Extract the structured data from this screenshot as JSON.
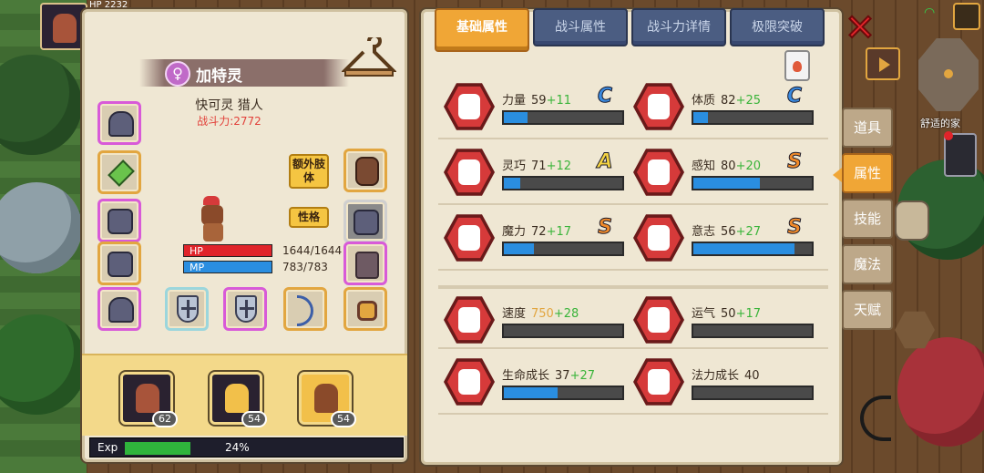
{
  "hud": {
    "mini_hp": "HP 2232",
    "location": "舒适的家"
  },
  "character": {
    "gender_symbol": "♀",
    "name": "加特灵",
    "class": "快可灵 猎人",
    "power_label": "战斗力:",
    "power_value": "2772",
    "extra_body_button": "额外肢体",
    "personality_button": "性格",
    "hp_label": "HP",
    "hp_value": "1644/1644",
    "mp_label": "MP",
    "mp_value": "783/783"
  },
  "party": [
    {
      "level": "62"
    },
    {
      "level": "54"
    },
    {
      "level": "54"
    }
  ],
  "exp": {
    "label": "Exp",
    "value": "24%",
    "fraction": 0.24
  },
  "tabs": [
    {
      "label": "基础属性",
      "active": true
    },
    {
      "label": "战斗属性",
      "active": false
    },
    {
      "label": "战斗力详情",
      "active": false
    },
    {
      "label": "极限突破",
      "active": false
    }
  ],
  "stats": [
    {
      "name": "力量",
      "value": "59",
      "bonus": "+11",
      "grade": "C",
      "fill": 0.2,
      "icon": "muscle-icon"
    },
    {
      "name": "体质",
      "value": "82",
      "bonus": "+25",
      "grade": "C",
      "fill": 0.12,
      "icon": "body-icon"
    },
    {
      "name": "灵巧",
      "value": "71",
      "bonus": "+12",
      "grade": "A",
      "fill": 0.14,
      "icon": "running-icon"
    },
    {
      "name": "感知",
      "value": "80",
      "bonus": "+20",
      "grade": "S",
      "fill": 0.56,
      "icon": "eye-icon"
    },
    {
      "name": "魔力",
      "value": "72",
      "bonus": "+17",
      "grade": "S",
      "fill": 0.25,
      "icon": "hexagram-icon"
    },
    {
      "name": "意志",
      "value": "56",
      "bonus": "+27",
      "grade": "S",
      "fill": 0.85,
      "icon": "head-icon"
    },
    {
      "name": "速度",
      "value": "750",
      "bonus": "+28",
      "grade": "",
      "fill": 0,
      "icon": "wing-icon",
      "value_color": "gold"
    },
    {
      "name": "运气",
      "value": "50",
      "bonus": "+17",
      "grade": "",
      "fill": 0,
      "icon": "clover-icon"
    },
    {
      "name": "生命成长",
      "value": "37",
      "bonus": "+27",
      "grade": "",
      "fill": 0.45,
      "icon": "heart-icon"
    },
    {
      "name": "法力成长",
      "value": "40",
      "bonus": "",
      "grade": "",
      "fill": 0,
      "icon": "mana-icon"
    }
  ],
  "side_menu": [
    {
      "label": "道具",
      "active": false
    },
    {
      "label": "属性",
      "active": true
    },
    {
      "label": "技能",
      "active": false
    },
    {
      "label": "魔法",
      "active": false
    },
    {
      "label": "天赋",
      "active": false
    }
  ],
  "colors": {
    "accent": "#f0a636",
    "hp": "#e0242a",
    "mp": "#2a8ee0",
    "bonus": "#3ab43a",
    "power": "#e2403a"
  }
}
